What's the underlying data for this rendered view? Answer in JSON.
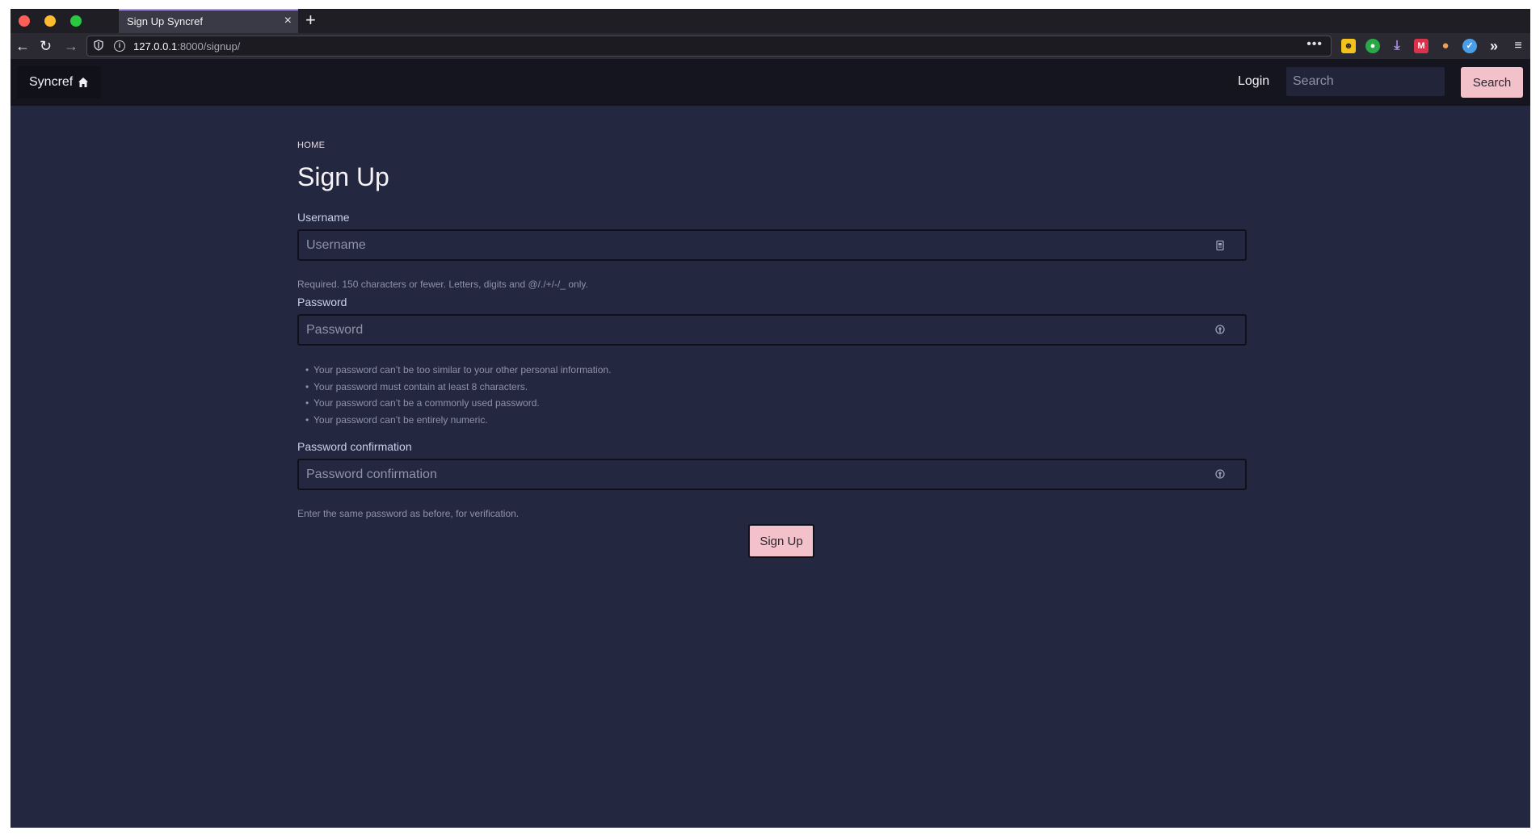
{
  "browser": {
    "tab_title": "Sign Up Syncref",
    "tab_close": "×",
    "new_tab": "+",
    "url_host": "127.0.0.1",
    "url_path": ":8000/signup/",
    "nav_back": "←",
    "nav_reload": "↻",
    "nav_forward": "→",
    "url_more": "•••",
    "overflow": "»",
    "menu": "≡"
  },
  "site": {
    "brand": "Syncref",
    "login": "Login",
    "search_placeholder": "Search",
    "search_button": "Search"
  },
  "page": {
    "breadcrumb": "HOME",
    "title": "Sign Up",
    "username": {
      "label": "Username",
      "placeholder": "Username",
      "help": "Required. 150 characters or fewer. Letters, digits and @/./+/-/_ only."
    },
    "password": {
      "label": "Password",
      "placeholder": "Password",
      "rules": [
        "Your password can’t be too similar to your other personal information.",
        "Your password must contain at least 8 characters.",
        "Your password can’t be a commonly used password.",
        "Your password can’t be entirely numeric."
      ]
    },
    "password_confirmation": {
      "label": "Password confirmation",
      "placeholder": "Password confirmation",
      "help": "Enter the same password as before, for verification."
    },
    "submit": "Sign Up"
  },
  "colors": {
    "page_bg": "#23273f",
    "header_bg": "#14151f",
    "accent_button": "#f2c1c9",
    "text_muted": "#8f92a8"
  }
}
